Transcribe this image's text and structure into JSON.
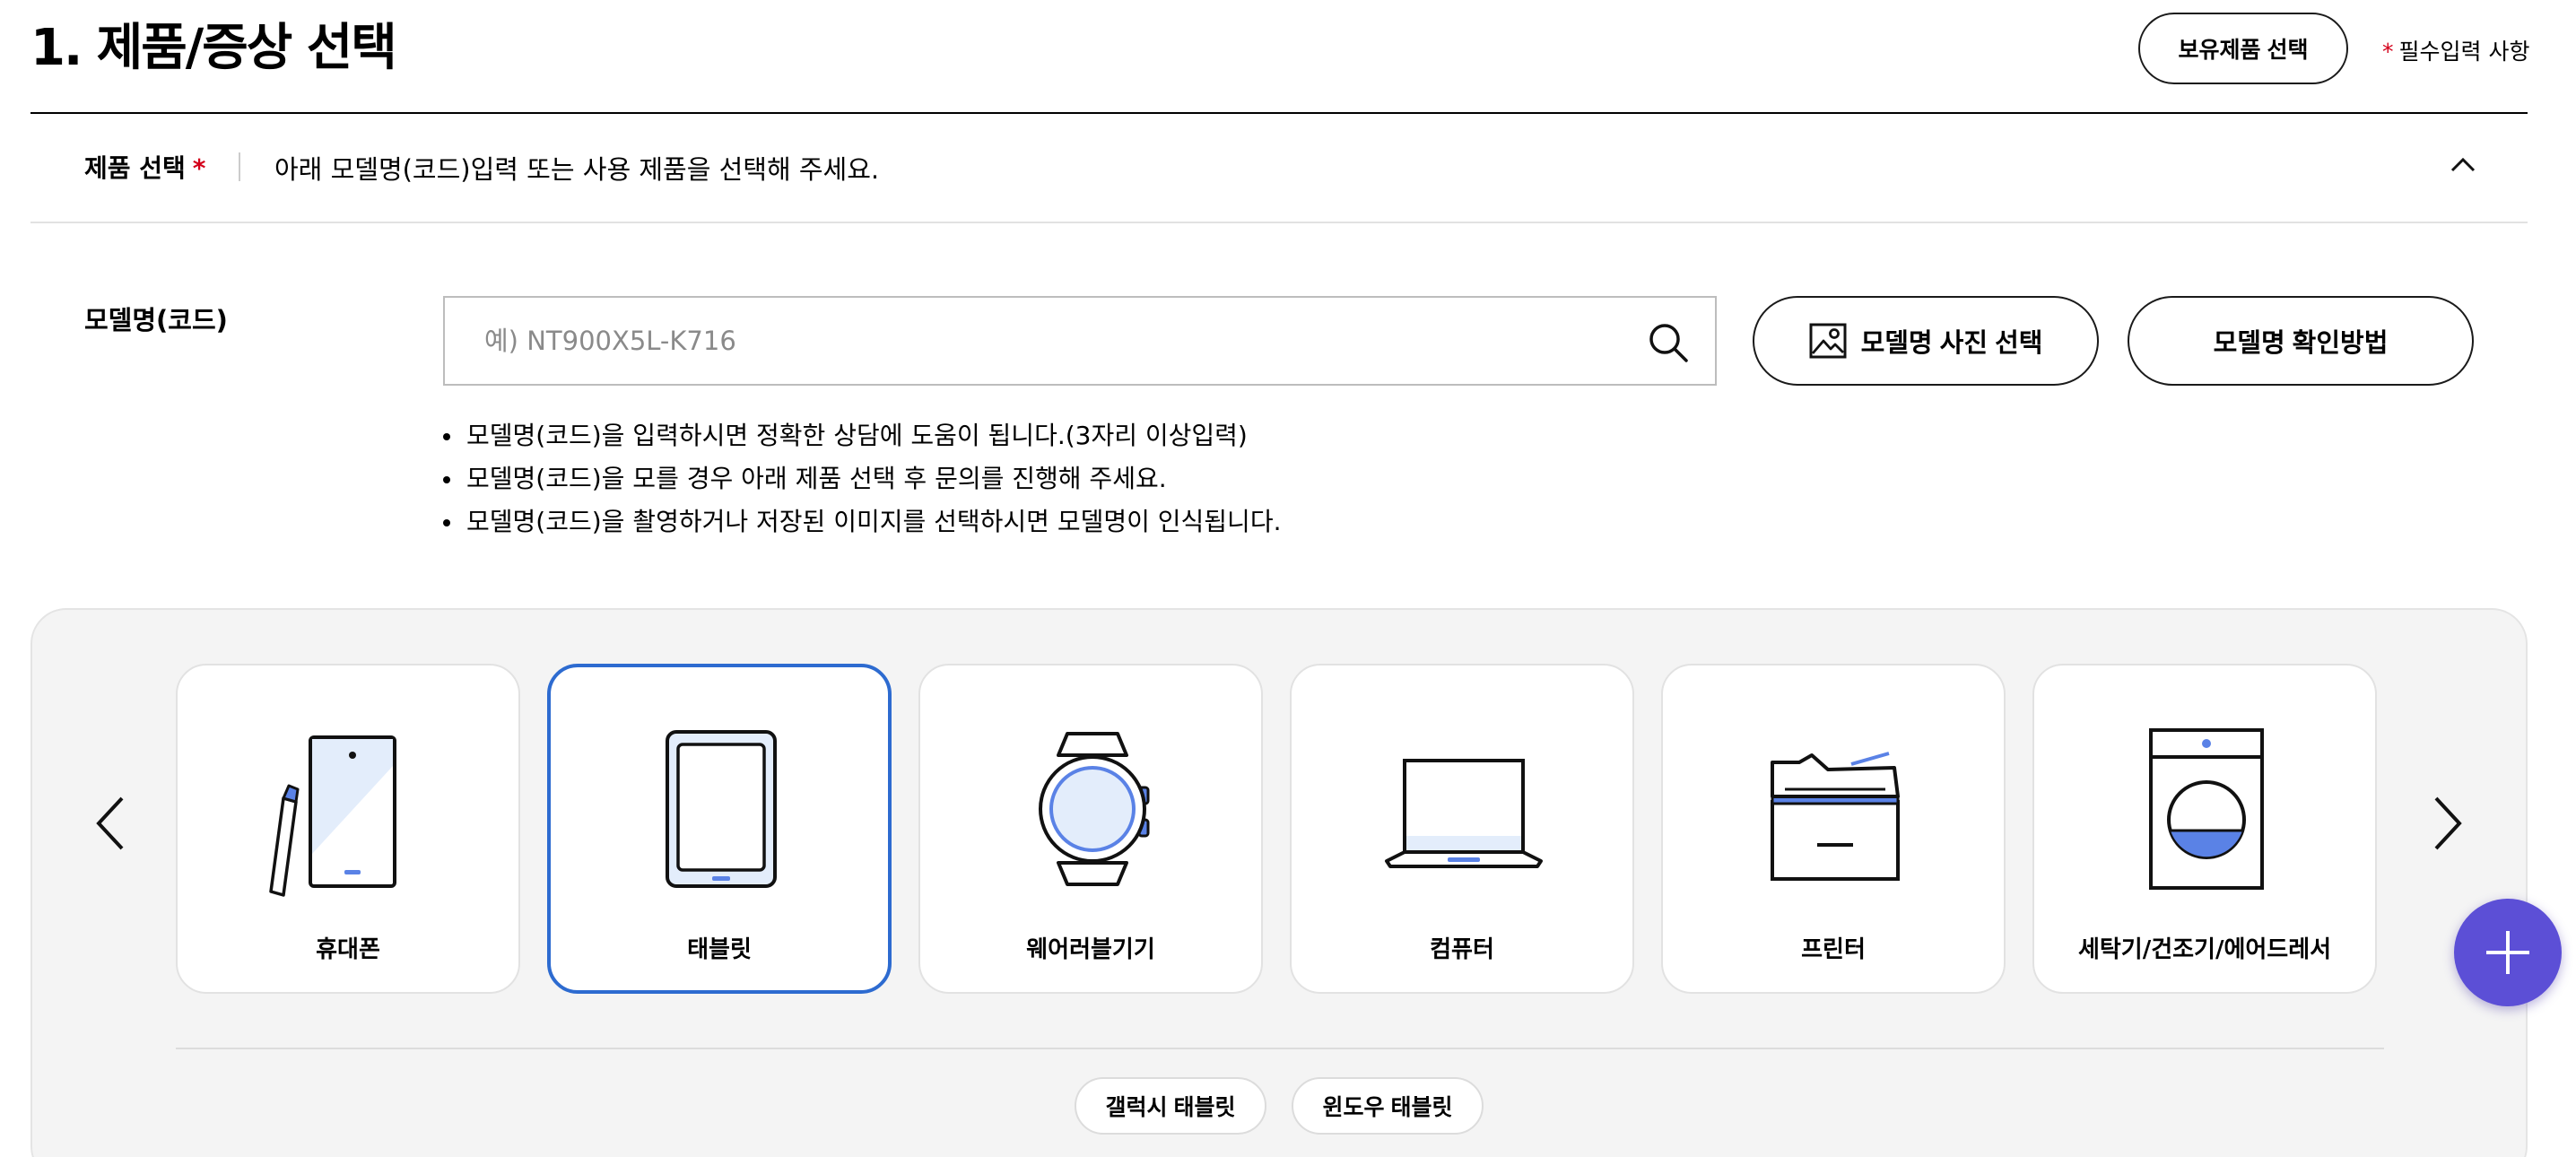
{
  "header": {
    "title": "1. 제품/증상 선택",
    "owned_products_button": "보유제품 선택",
    "required_star": "*",
    "required_note": "필수입력 사항"
  },
  "product_select": {
    "label": "제품 선택",
    "required_star": "*",
    "description": "아래 모델명(코드)입력 또는 사용 제품을 선택해 주세요."
  },
  "model_code": {
    "label": "모델명(코드)",
    "input_value": "",
    "input_placeholder": "예) NT900X5L-K716",
    "photo_button": "모델명 사진 선택",
    "howto_button": "모델명 확인방법",
    "tips": [
      "모델명(코드)을 입력하시면 정확한 상담에 도움이 됩니다.(3자리 이상입력)",
      "모델명(코드)을 모를 경우 아래 제품 선택 후 문의를 진행해 주세요.",
      "모델명(코드)을 촬영하거나 저장된 이미지를 선택하시면 모델명이 인식됩니다."
    ]
  },
  "categories": {
    "selected_index": 1,
    "selected_color": "#2d6bd0",
    "accent_color": "#5a82e6",
    "items": [
      {
        "label": "휴대폰",
        "icon": "mobile-phone-icon"
      },
      {
        "label": "태블릿",
        "icon": "tablet-icon"
      },
      {
        "label": "웨어러블기기",
        "icon": "smartwatch-icon"
      },
      {
        "label": "컴퓨터",
        "icon": "laptop-icon"
      },
      {
        "label": "프린터",
        "icon": "printer-icon"
      },
      {
        "label": "세탁기/건조기/에어드레서",
        "icon": "washing-machine-icon"
      }
    ],
    "subcategories": [
      "갤럭시 태블릿",
      "윈도우 태블릿"
    ]
  },
  "fab": {
    "icon": "plus-icon",
    "color": "#5c4fd6"
  }
}
